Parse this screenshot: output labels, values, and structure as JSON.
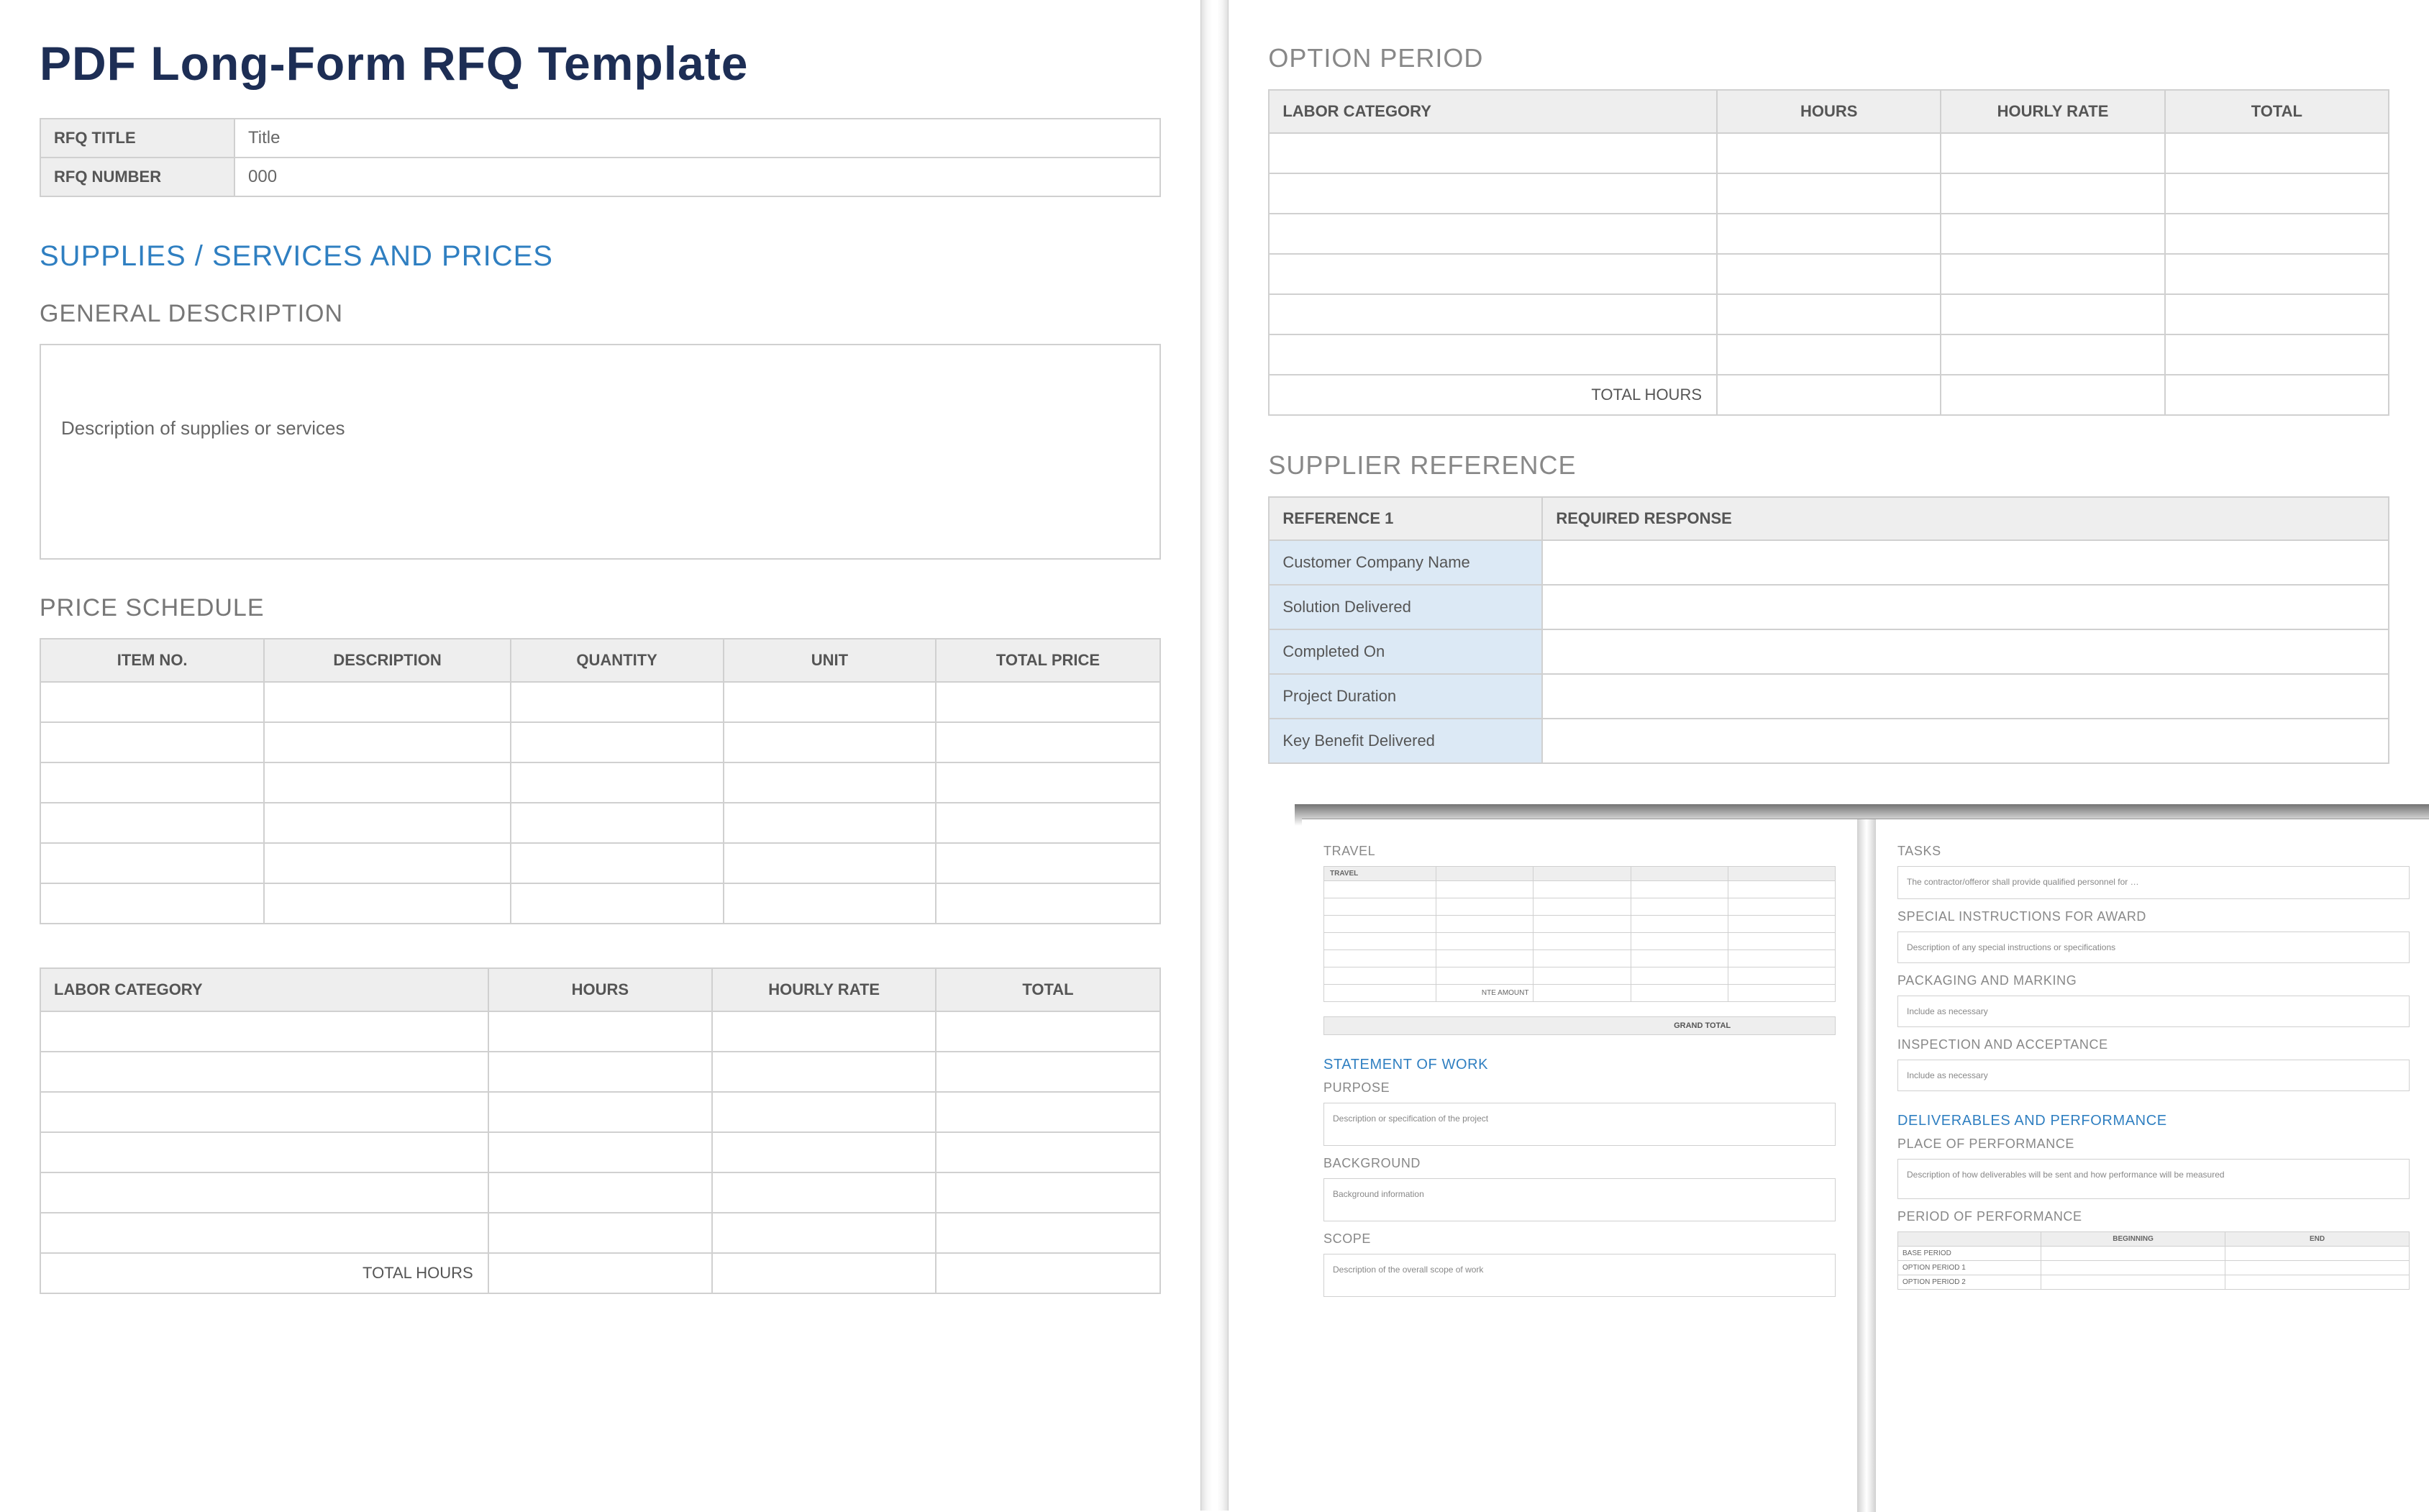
{
  "page1": {
    "title": "PDF Long-Form RFQ Template",
    "info_rows": [
      {
        "label": "RFQ TITLE",
        "value": "Title"
      },
      {
        "label": "RFQ NUMBER",
        "value": "000"
      }
    ],
    "section_supplies": "SUPPLIES / SERVICES AND PRICES",
    "general_desc_head": "GENERAL DESCRIPTION",
    "general_desc_text": "Description of supplies or services",
    "price_schedule_head": "PRICE SCHEDULE",
    "price_cols": [
      "ITEM NO.",
      "DESCRIPTION",
      "QUANTITY",
      "UNIT",
      "TOTAL PRICE"
    ],
    "labor1_cols": [
      "LABOR CATEGORY",
      "HOURS",
      "HOURLY RATE",
      "TOTAL"
    ],
    "total_hours_label": "TOTAL HOURS"
  },
  "page2": {
    "option_head": "OPTION PERIOD",
    "labor_cols": [
      "LABOR CATEGORY",
      "HOURS",
      "HOURLY RATE",
      "TOTAL"
    ],
    "total_hours_label": "TOTAL HOURS",
    "supplier_ref_head": "SUPPLIER REFERENCE",
    "ref_header": [
      "REFERENCE 1",
      "REQUIRED RESPONSE"
    ],
    "ref_rows": [
      "Customer Company Name",
      "Solution Delivered",
      "Completed On",
      "Project Duration",
      "Key Benefit Delivered"
    ]
  },
  "overlay_left": {
    "travel_head": "TRAVEL",
    "travel_col": "TRAVEL",
    "nte_label": "NTE AMOUNT",
    "grand_total": "GRAND TOTAL",
    "sow_head": "STATEMENT OF WORK",
    "purpose_head": "PURPOSE",
    "purpose_text": "Description or specification of the project",
    "background_head": "BACKGROUND",
    "background_text": "Background information",
    "scope_head": "SCOPE",
    "scope_text": "Description of the overall scope of work"
  },
  "overlay_right": {
    "tasks_head": "TASKS",
    "tasks_text": "The contractor/offeror shall provide qualified personnel for …",
    "special_head": "SPECIAL INSTRUCTIONS FOR AWARD",
    "special_text": "Description of any special instructions or specifications",
    "packaging_head": "PACKAGING AND MARKING",
    "packaging_text": "Include as necessary",
    "inspection_head": "INSPECTION AND ACCEPTANCE",
    "inspection_text": "Include as necessary",
    "deliverables_head": "DELIVERABLES AND PERFORMANCE",
    "place_head": "PLACE OF PERFORMANCE",
    "place_text": "Description of how deliverables will be sent and how performance will be measured",
    "period_head": "PERIOD OF PERFORMANCE",
    "period_cols": [
      "",
      "BEGINNING",
      "END"
    ],
    "period_rows": [
      "BASE PERIOD",
      "OPTION PERIOD 1",
      "OPTION PERIOD 2"
    ]
  }
}
